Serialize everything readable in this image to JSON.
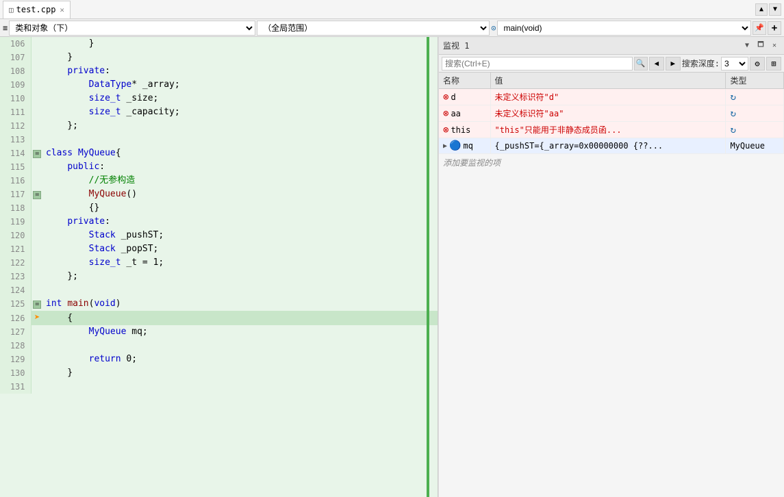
{
  "titlebar": {
    "tab_name": "test.cpp",
    "tab_icon": "⊞",
    "arrow_up": "▲",
    "arrow_down": "▼"
  },
  "toolbar_left": {
    "class_select_label": "≡ 类和对象（下）",
    "scope_select_label": "（全局范围）",
    "func_icon": "⊙",
    "func_select_label": "main(void)",
    "pin_icon": "📌",
    "add_icon": "+"
  },
  "code": {
    "lines": [
      {
        "num": "106",
        "indent": 2,
        "content": "    }"
      },
      {
        "num": "107",
        "indent": 2,
        "content": "    }"
      },
      {
        "num": "108",
        "indent": 1,
        "content": "  private:"
      },
      {
        "num": "109",
        "indent": 2,
        "content": "    DataType* _array;"
      },
      {
        "num": "110",
        "indent": 2,
        "content": "    size_t _size;"
      },
      {
        "num": "111",
        "indent": 2,
        "content": "    size_t _capacity;"
      },
      {
        "num": "112",
        "indent": 1,
        "content": "  };"
      },
      {
        "num": "113",
        "indent": 0,
        "content": ""
      },
      {
        "num": "114",
        "indent": 0,
        "content": "=class MyQueue{"
      },
      {
        "num": "115",
        "indent": 1,
        "content": "  public:"
      },
      {
        "num": "116",
        "indent": 2,
        "content": "    //无参构造"
      },
      {
        "num": "117",
        "indent": 2,
        "content": "    MyQueue()"
      },
      {
        "num": "118",
        "indent": 2,
        "content": "    {}"
      },
      {
        "num": "119",
        "indent": 1,
        "content": "  private:"
      },
      {
        "num": "120",
        "indent": 2,
        "content": "    Stack _pushST;"
      },
      {
        "num": "121",
        "indent": 2,
        "content": "    Stack _popST;"
      },
      {
        "num": "122",
        "indent": 2,
        "content": "    size_t _t = 1;"
      },
      {
        "num": "123",
        "indent": 1,
        "content": "  };"
      },
      {
        "num": "124",
        "indent": 0,
        "content": ""
      },
      {
        "num": "125",
        "indent": 0,
        "content": "=int main(void)"
      },
      {
        "num": "126",
        "indent": 0,
        "content": "  {"
      },
      {
        "num": "127",
        "indent": 2,
        "content": "    MyQueue mq;"
      },
      {
        "num": "128",
        "indent": 0,
        "content": ""
      },
      {
        "num": "129",
        "indent": 2,
        "content": "    return 0;"
      },
      {
        "num": "130",
        "indent": 1,
        "content": "  }"
      },
      {
        "num": "131",
        "indent": 0,
        "content": ""
      }
    ]
  },
  "watch": {
    "panel_title": "监视 1",
    "search_placeholder": "搜索(Ctrl+E)",
    "depth_label": "搜索深度:",
    "depth_value": "3",
    "nav_back": "◀",
    "nav_forward": "▶",
    "col_name": "名称",
    "col_value": "值",
    "col_type": "类型",
    "add_row_text": "添加要监视的项",
    "rows": [
      {
        "icon": "error",
        "name": "d",
        "value": "未定义标识符\"d\"",
        "type": "",
        "has_refresh": true
      },
      {
        "icon": "error",
        "name": "aa",
        "value": "未定义标识符\"aa\"",
        "type": "",
        "has_refresh": true
      },
      {
        "icon": "error",
        "name": "this",
        "value": "\"this\"只能用于非静态成员函...",
        "type": "",
        "has_refresh": true
      },
      {
        "icon": "object",
        "name": "mq",
        "value": "{_pushST={_array=0x00000000 {??...",
        "type": "MyQueue",
        "has_refresh": false,
        "expandable": true
      }
    ],
    "btn_dropdown": "▼",
    "btn_restore": "🗖",
    "btn_close": "✕"
  }
}
